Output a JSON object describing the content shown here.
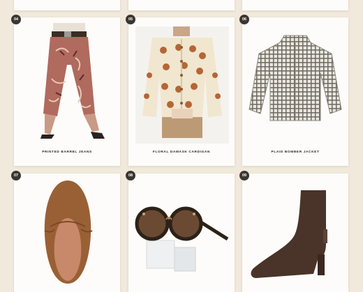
{
  "products": [
    {
      "number": "04",
      "name": "PRINTED BARREL JEANS",
      "image_icon": "printed-barrel-jeans-photo"
    },
    {
      "number": "05",
      "name": "FLORAL DAMASK CARDIGAN",
      "image_icon": "floral-damask-cardigan-photo"
    },
    {
      "number": "06",
      "name": "PLAID BOMBER JACKET",
      "image_icon": "plaid-bomber-jacket-photo"
    },
    {
      "number": "07",
      "name": "",
      "image_icon": "suede-ballet-flat-photo"
    },
    {
      "number": "08",
      "name": "",
      "image_icon": "round-tortoise-sunglasses-photo"
    },
    {
      "number": "09",
      "name": "",
      "image_icon": "suede-ankle-boot-photo"
    }
  ],
  "colors": {
    "background": "#f1e9dc",
    "card": "#fdfcfa",
    "badge": "#3b3631",
    "text": "#2d2a27"
  }
}
